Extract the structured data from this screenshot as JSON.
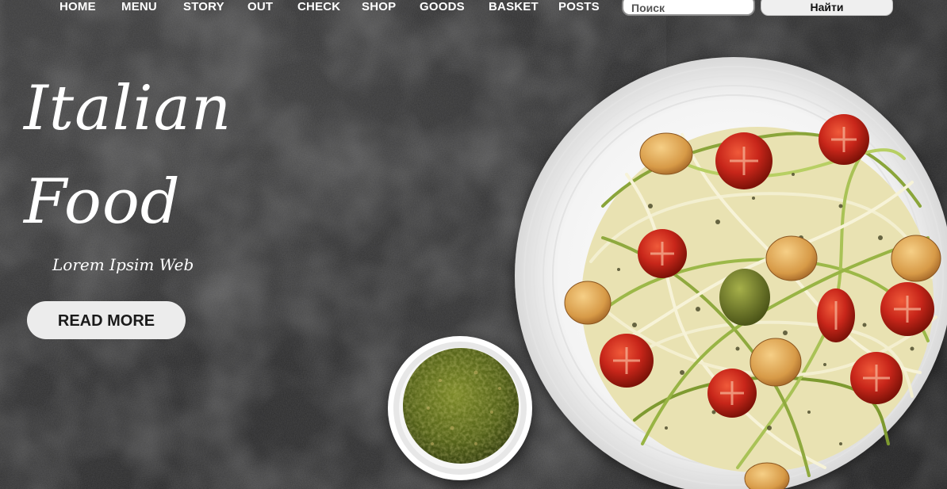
{
  "nav": {
    "items": [
      "HOME",
      "MENU",
      "STORY",
      "OUT",
      "CHECK",
      "SHOP",
      "GOODS",
      "BASKET",
      "POSTS"
    ]
  },
  "search": {
    "placeholder": "Поиск",
    "button_label": "Найти"
  },
  "hero": {
    "title_line1": "Italian",
    "title_line2": "Food",
    "subtitle": "Lorem Ipsim Web",
    "cta_label": "READ MORE"
  },
  "colors": {
    "background": "#2e2e2f",
    "text": "#ffffff",
    "button_bg": "#ececec",
    "tomato": "#c8261a",
    "pesto": "#5a6a1c"
  },
  "icons": {
    "plate": "pasta-plate-image",
    "bowl": "pesto-bowl-image"
  }
}
